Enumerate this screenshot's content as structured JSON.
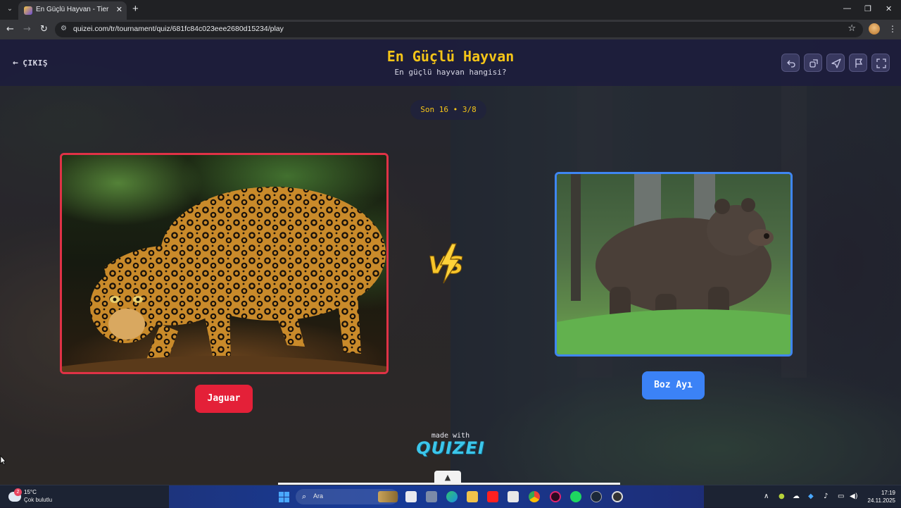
{
  "browser": {
    "tab_title": "En Güçlü Hayvan - Tier List, Kör Tur",
    "tab_close": "✕",
    "new_tab": "+",
    "url": "quizei.com/tr/tournament/quiz/681fc84c023eee2680d15234/play",
    "window_controls": {
      "minimize": "—",
      "restore": "❐",
      "close": "✕"
    }
  },
  "header": {
    "exit_label": "ÇIKIŞ",
    "title": "En Güçlü Hayvan",
    "subtitle": "En güçlü hayvan hangisi?",
    "action_icons": [
      "undo-icon",
      "share-icon",
      "send-icon",
      "flag-icon",
      "fullscreen-icon"
    ]
  },
  "round": {
    "label": "Son 16 • 3/8"
  },
  "matchup": {
    "left": {
      "name": "Jaguar",
      "accent": "#e42038"
    },
    "right": {
      "name": "Boz Ayı",
      "accent": "#3b82f6"
    },
    "vs_label": "VS"
  },
  "footer": {
    "made_with": "made with",
    "brand": "QUIZEI",
    "scroll_up": "^"
  },
  "taskbar": {
    "weather_badge": "2",
    "temperature": "15°C",
    "condition": "Çok bulutlu",
    "search_placeholder": "Ara",
    "time": "17:19",
    "date": "24.11.2025"
  },
  "colors": {
    "title_yellow": "#f5c518",
    "header_bg": "#1c1c3c",
    "left_accent": "#e42038",
    "right_accent": "#3b82f6",
    "brand_cyan": "#3cc6ea"
  }
}
